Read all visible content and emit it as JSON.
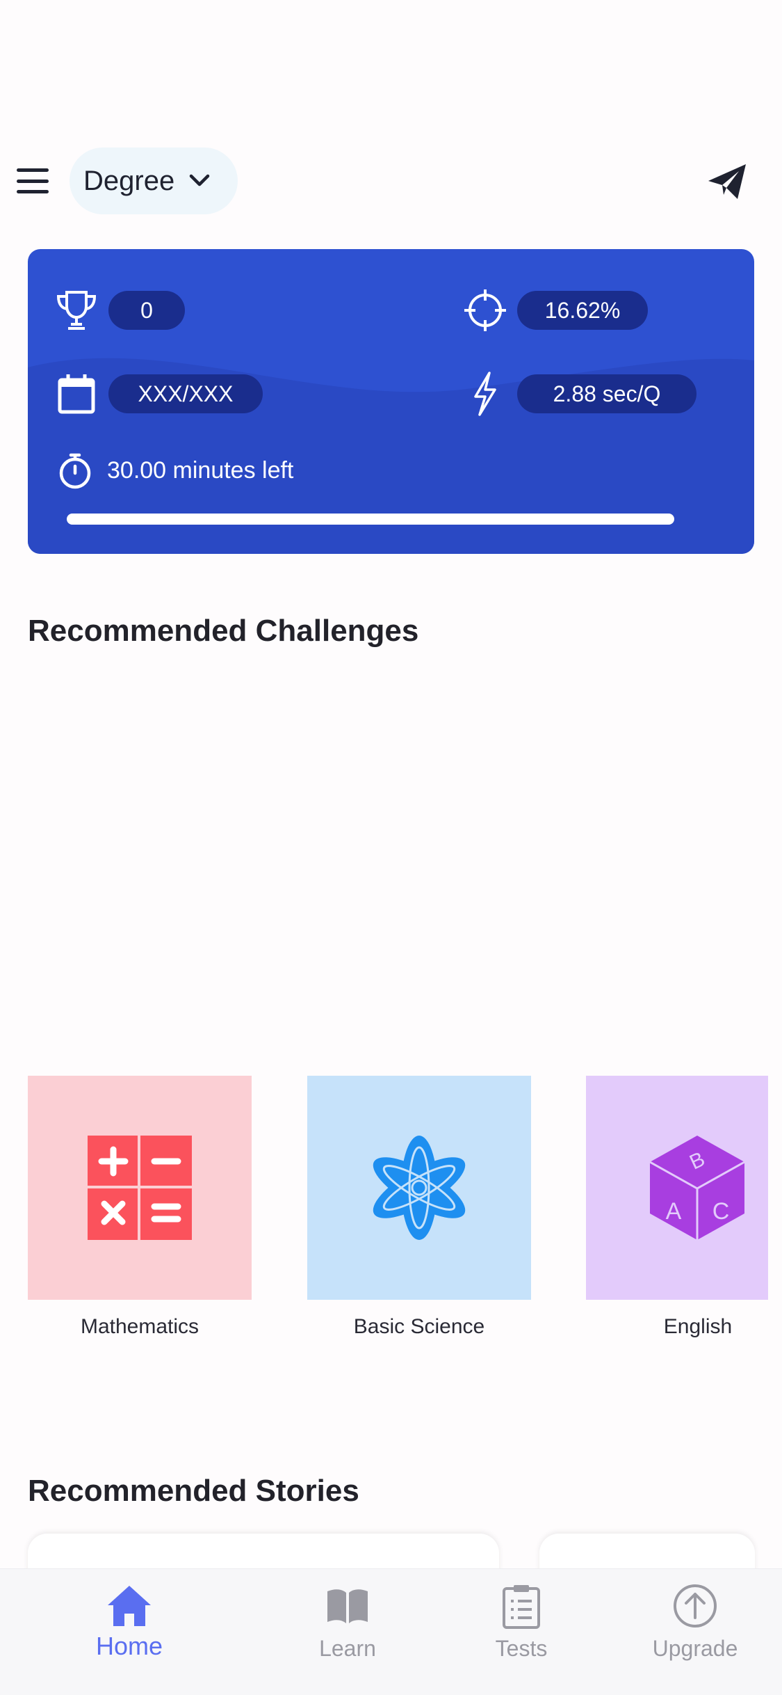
{
  "header": {
    "degree_label": "Degree"
  },
  "stats": {
    "trophy_value": "0",
    "accuracy_value": "16.62%",
    "progress_value": "XXX/XXX",
    "speed_value": "2.88 sec/Q",
    "timer_label": "30.00 minutes left"
  },
  "challenges": {
    "title": "Recommended Challenges",
    "subjects": [
      {
        "label": "Mathematics",
        "bg": "#fbcfd4",
        "icon": "calculator-icon",
        "color": "#fb525c"
      },
      {
        "label": "Basic Science",
        "bg": "#c6e2fa",
        "icon": "atom-icon",
        "color": "#1e8ff0"
      },
      {
        "label": "English",
        "bg": "#e3cbfb",
        "icon": "abc-cube-icon",
        "color": "#a83ee0"
      }
    ]
  },
  "stories": {
    "title": "Recommended Stories"
  },
  "nav": {
    "items": [
      {
        "label": "Home",
        "icon": "home-icon",
        "active": true
      },
      {
        "label": "Learn",
        "icon": "book-icon"
      },
      {
        "label": "Tests",
        "icon": "clipboard-icon"
      },
      {
        "label": "Upgrade",
        "icon": "upgrade-icon"
      }
    ]
  },
  "colors": {
    "card_blue": "#2e51d1",
    "pill_dark": "#1a2d8d",
    "accent": "#5a6ef0"
  }
}
